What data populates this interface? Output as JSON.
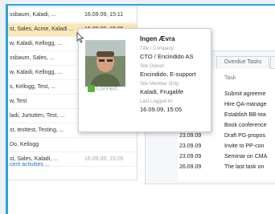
{
  "activity_rows": [
    {
      "who": "ssbaum, Kaladi, ...",
      "when": "16.09.09, 15:11"
    },
    {
      "who": "st, Sales, Acme, Kaladi ...",
      "when": "16.09.09, 15:05"
    },
    {
      "who": "w, Kaladi, Kellogg, ...",
      "when": ""
    },
    {
      "who": "ssbaum, Sales, ...",
      "when": ""
    },
    {
      "who": "w, Kaladi, Kellogg, ...",
      "when": ""
    },
    {
      "who": "s, Kellogg, Test, ...",
      "when": ""
    },
    {
      "who": "w, Test",
      "when": ""
    },
    {
      "who": "ladi, Jurtutten, Test, ...",
      "when": ""
    },
    {
      "who": "st, testtest, Testing, ...",
      "when": ""
    },
    {
      "who": "Do, Kellogg",
      "when": ""
    },
    {
      "who": "st, Sales, Kaladi, ...",
      "when": "16.09.09, 15:05"
    }
  ],
  "recent_link": "cent activities ...",
  "tabs": {
    "overdue": "Overdue Tasks"
  },
  "task_header": "Task",
  "tasks": [
    {
      "date": "",
      "title": "Submit agreeme"
    },
    {
      "date": "",
      "title": "Hire QA-manage"
    },
    {
      "date": "",
      "title": "Establish BB-tea"
    },
    {
      "date": "",
      "title": "Book conference"
    },
    {
      "date": "23.09.09",
      "title": "Draft PG-propos"
    },
    {
      "date": "23.09.09",
      "title": "Invite to PP-con"
    },
    {
      "date": "23.09.09",
      "title": "Seminar on CMA"
    },
    {
      "date": "26.09.09",
      "title": "The last task on"
    }
  ],
  "profile": {
    "name": "Ingen Ævra",
    "title_label": "Title / Company:",
    "title_value": "CTO / Encindido AS",
    "owner_label": "Site Owner:",
    "owner_value": "Encindido, E-support",
    "member_label": "Site Member Only:",
    "member_value": "Kaladi, Frugalife",
    "login_label": "Last Logged In:",
    "login_value": "16.09.09, 15:05",
    "connect": "Connect"
  },
  "colors": {
    "frame": "#2ba3dc",
    "selected": "#fbe8b8",
    "link": "#2a73c9"
  }
}
